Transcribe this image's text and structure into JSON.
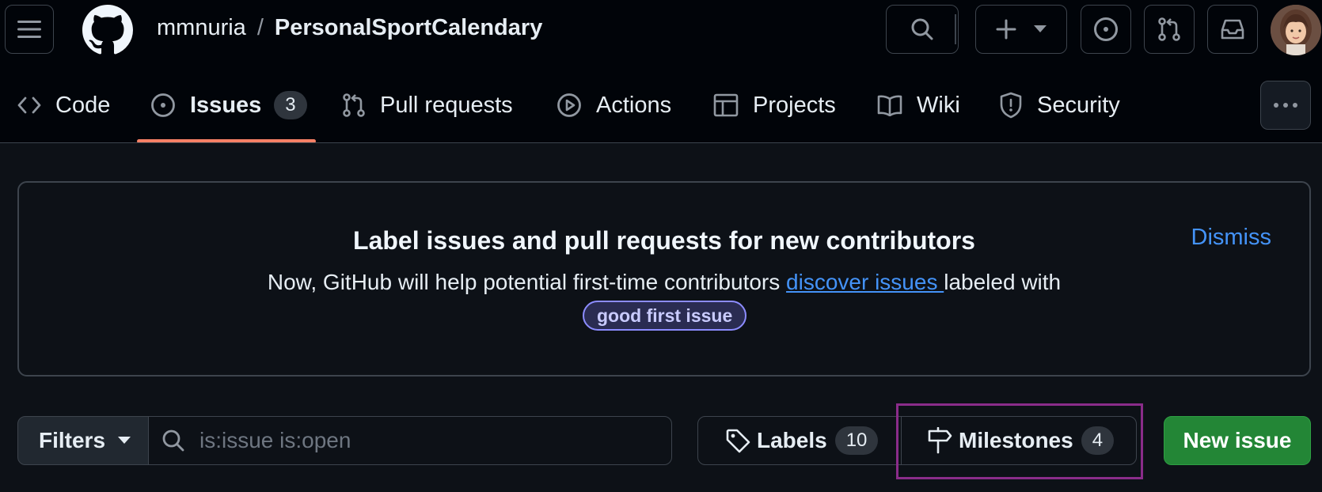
{
  "header": {
    "owner": "mmnuria",
    "separator": "/",
    "repo": "PersonalSportCalendary"
  },
  "tabs": [
    {
      "label": "Code",
      "icon": "code-icon"
    },
    {
      "label": "Issues",
      "icon": "issue-opened-icon",
      "count": "3",
      "active": true
    },
    {
      "label": "Pull requests",
      "icon": "git-pull-request-icon"
    },
    {
      "label": "Actions",
      "icon": "play-icon"
    },
    {
      "label": "Projects",
      "icon": "table-icon"
    },
    {
      "label": "Wiki",
      "icon": "book-icon"
    },
    {
      "label": "Security",
      "icon": "shield-icon"
    }
  ],
  "banner": {
    "title": "Label issues and pull requests for new contributors",
    "text_before": "Now, GitHub will help potential first-time contributors ",
    "link_text": "discover issues ",
    "text_after": "labeled with",
    "label": "good first issue",
    "dismiss": "Dismiss"
  },
  "filterbar": {
    "filters_label": "Filters",
    "search_placeholder": "is:issue is:open",
    "labels_label": "Labels",
    "labels_count": "10",
    "milestones_label": "Milestones",
    "milestones_count": "4",
    "new_issue_label": "New issue"
  },
  "colors": {
    "accent_underline": "#f78166",
    "link": "#4493f8",
    "primary_button": "#238636",
    "highlight_box": "#8a2c8a"
  }
}
